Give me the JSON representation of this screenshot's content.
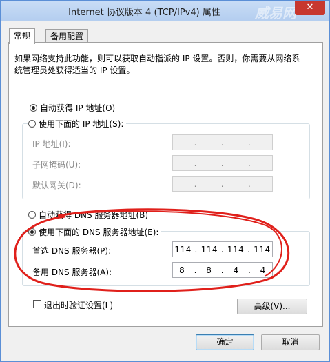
{
  "window": {
    "title": "Internet 协议版本 4 (TCP/IPv4) 属性",
    "close_glyph": "✕",
    "watermark_text": "威易网"
  },
  "tabs": [
    {
      "label": "常规",
      "active": true
    },
    {
      "label": "备用配置",
      "active": false
    }
  ],
  "description": "如果网络支持此功能，则可以获取自动指派的 IP 设置。否则，你需要从网络系统管理员处获得适当的 IP 设置。",
  "ip_section": {
    "auto_label": "自动获得 IP 地址(O)",
    "auto_selected": true,
    "manual_label": "使用下面的 IP 地址(S):",
    "manual_selected": false,
    "fields": [
      {
        "label": "IP 地址(I):",
        "octets": [
          "",
          "",
          "",
          ""
        ]
      },
      {
        "label": "子网掩码(U):",
        "octets": [
          "",
          "",
          "",
          ""
        ]
      },
      {
        "label": "默认网关(D):",
        "octets": [
          "",
          "",
          "",
          ""
        ]
      }
    ]
  },
  "dns_section": {
    "auto_label": "自动获得 DNS 服务器地址(B)",
    "auto_selected": false,
    "manual_label": "使用下面的 DNS 服务器地址(E):",
    "manual_selected": true,
    "preferred": {
      "label": "首选 DNS 服务器(P):",
      "octets": [
        "114",
        "114",
        "114",
        "114"
      ]
    },
    "alternate": {
      "label": "备用 DNS 服务器(A):",
      "octets": [
        "8",
        "8",
        "4",
        "4"
      ]
    }
  },
  "validate_on_exit": {
    "label": "退出时验证设置(L)",
    "checked": false
  },
  "advanced_button": "高级(V)...",
  "ok_button": "确定",
  "cancel_button": "取消",
  "colors": {
    "annotation": "#e0201b",
    "title_bar": "#b9d1f2",
    "close_button": "#c7372f"
  }
}
